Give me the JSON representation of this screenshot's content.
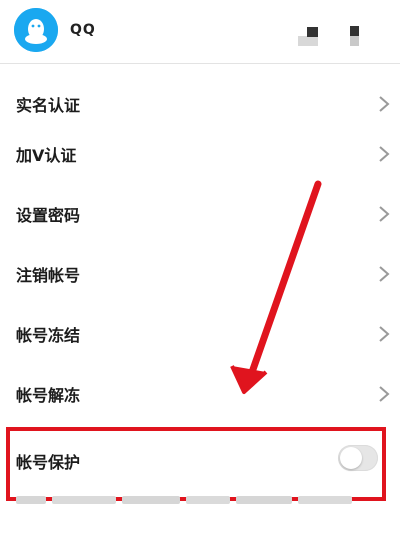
{
  "header": {
    "title": "QQ"
  },
  "settings": {
    "items": [
      {
        "label": "实名认证"
      },
      {
        "label": "加V认证"
      },
      {
        "label": "设置密码"
      },
      {
        "label": "注销帐号"
      },
      {
        "label": "帐号冻结"
      },
      {
        "label": "帐号解冻"
      }
    ],
    "protect": {
      "label": "帐号保护",
      "enabled": false
    }
  },
  "colors": {
    "accent": "#1aa8f0",
    "highlight": "#e0141e"
  },
  "icons": {
    "app": "qq-penguin-icon",
    "chevron": "chevron-right-icon"
  }
}
